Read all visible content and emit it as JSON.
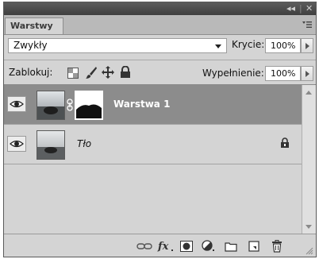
{
  "titlebar": {
    "collapse_glyph": "◂◂",
    "close_glyph": "✕"
  },
  "tab": {
    "label": "Warstwy"
  },
  "blend": {
    "mode": "Zwykły",
    "opacity_label": "Krycie:",
    "opacity_value": "100%"
  },
  "lock": {
    "label": "Zablokuj:",
    "fill_label": "Wypełnienie:",
    "fill_value": "100%"
  },
  "layers": [
    {
      "name": "Warstwa 1",
      "selected": true,
      "visible": true,
      "has_mask": true
    },
    {
      "name": "Tło",
      "selected": false,
      "visible": true,
      "locked": true
    }
  ],
  "bottom_icons": [
    "link-layers-icon",
    "fx-icon",
    "add-mask-icon",
    "adjustment-layer-icon",
    "new-group-icon",
    "new-layer-icon",
    "trash-icon"
  ],
  "colors": {
    "panel_bg": "#d4d4d4",
    "selected_row": "#8c8c8c",
    "titlebar": "#4a4a4a"
  }
}
